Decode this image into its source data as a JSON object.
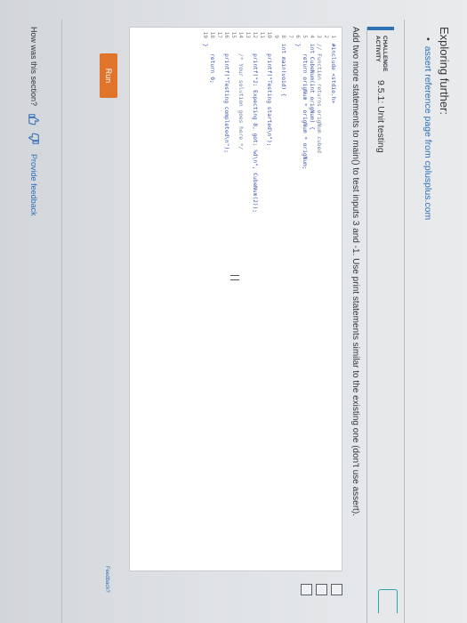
{
  "further": {
    "title": "Exploring further:",
    "bullet": "•",
    "link_text": "assert reference page from cplusplus.com"
  },
  "activity": {
    "type_label_line1": "CHALLENGE",
    "type_label_line2": "ACTIVITY",
    "title": "9.5.1: Unit testing",
    "prompt": "Add two more statements to main() to test inputs 3 and -1. Use print statements similar to the existing one (don't use assert)."
  },
  "editor": {
    "lines": [
      {
        "num": "1",
        "text": "#include <stdio.h>",
        "style": "code"
      },
      {
        "num": "2",
        "text": "",
        "style": "code"
      },
      {
        "num": "3",
        "text": "// Function returns origNum cubed",
        "style": "comment"
      },
      {
        "num": "4",
        "text": "int CubeNum(int origNum) {",
        "style": "code"
      },
      {
        "num": "5",
        "text": "   return origNum * origNum * origNum;",
        "style": "code"
      },
      {
        "num": "6",
        "text": "}",
        "style": "code"
      },
      {
        "num": "7",
        "text": "",
        "style": "code"
      },
      {
        "num": "8",
        "text": "int main(void) {",
        "style": "code"
      },
      {
        "num": "9",
        "text": "",
        "style": "code"
      },
      {
        "num": "10",
        "text": "   printf(\"Testing started\\n\");",
        "style": "code"
      },
      {
        "num": "11",
        "text": "",
        "style": "code"
      },
      {
        "num": "12",
        "text": "   printf(\"2: Expecting 8, got: %d\\n\", CubeNum(2));",
        "style": "code"
      },
      {
        "num": "13",
        "text": "",
        "style": "code"
      },
      {
        "num": "14",
        "text": "   /* Your solution goes here */",
        "style": "comment"
      },
      {
        "num": "15",
        "text": "",
        "style": "code"
      },
      {
        "num": "16",
        "text": "   printf(\"Testing completed\\n\");",
        "style": "code"
      },
      {
        "num": "17",
        "text": "",
        "style": "code"
      },
      {
        "num": "18",
        "text": "   return 0;",
        "style": "code"
      },
      {
        "num": "19",
        "text": "}",
        "style": "code"
      }
    ]
  },
  "side_panel": {
    "labels": [
      "",
      "",
      "",
      "",
      "",
      ""
    ]
  },
  "run_label": "Run",
  "feedback_link": "Feedback?",
  "footer": {
    "question": "How was this section?",
    "provide_feedback": "Provide feedback"
  },
  "colors": {
    "accent": "#2e6fb5",
    "run": "#e0742a",
    "teal": "#2aa7a0"
  }
}
